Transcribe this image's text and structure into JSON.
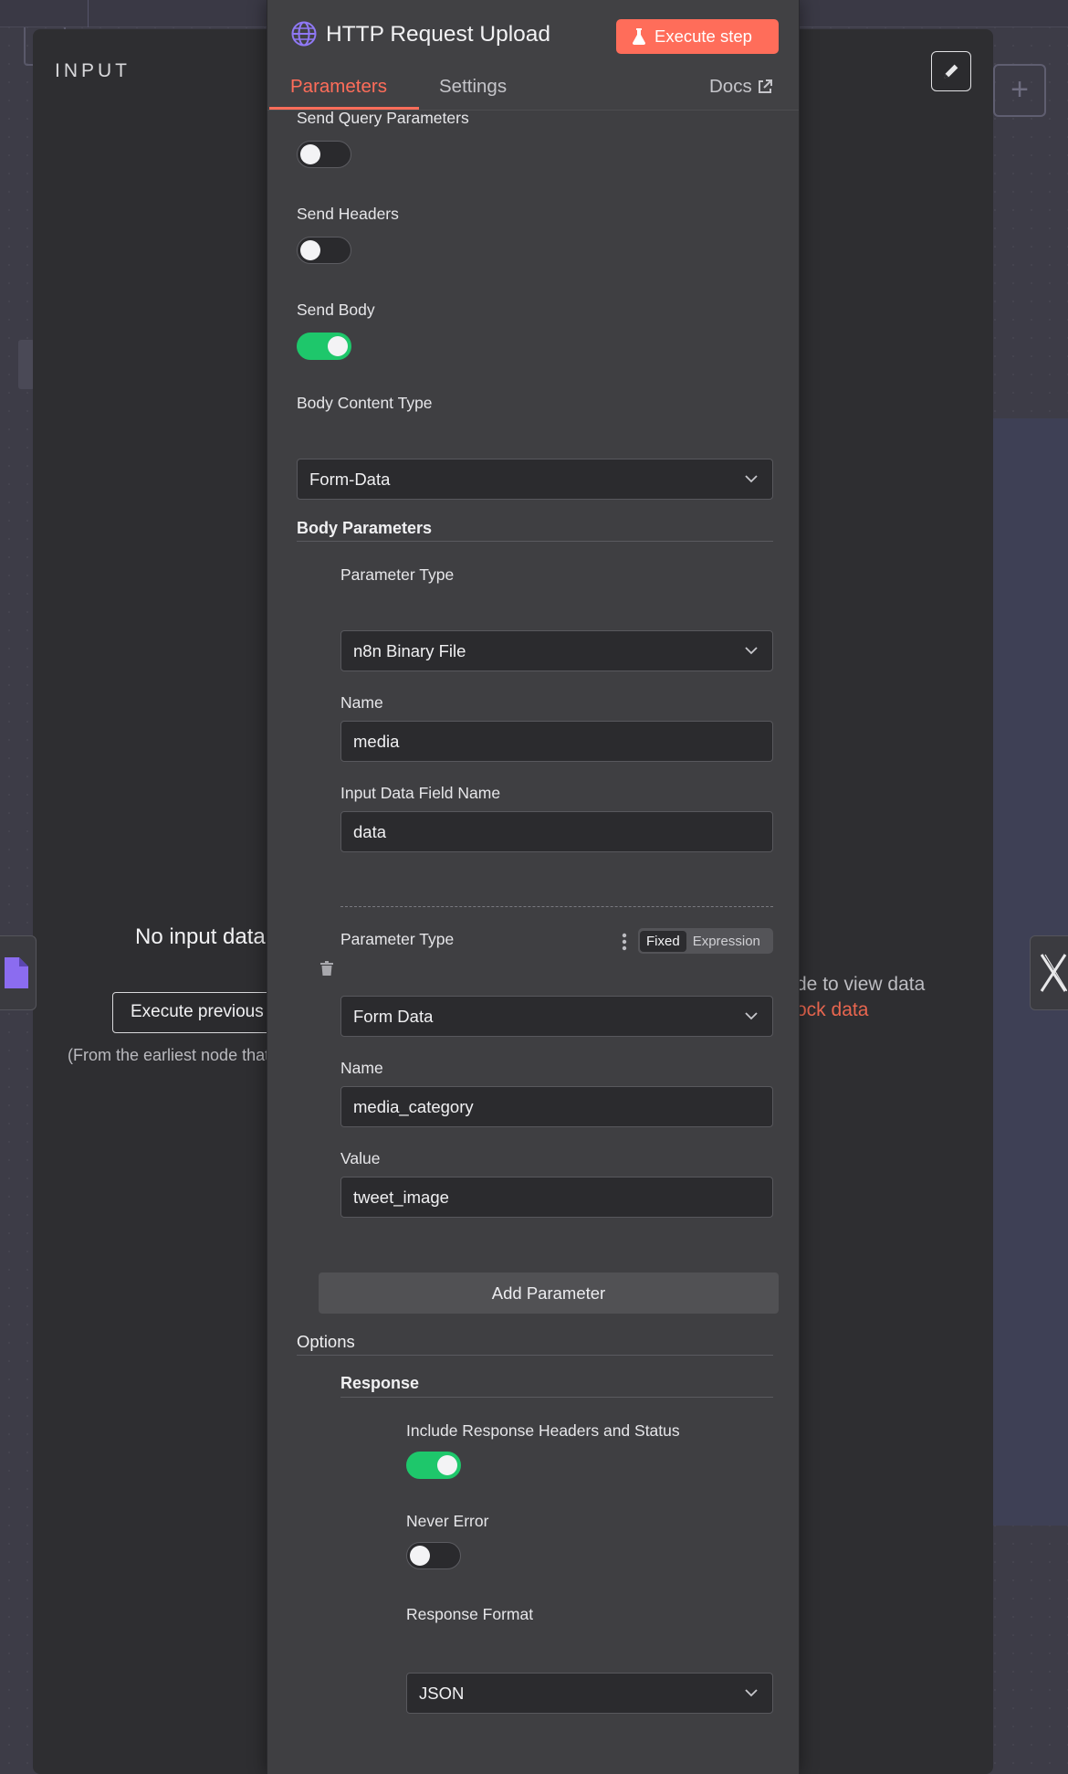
{
  "colors": {
    "accent": "#ff6d5a",
    "toggle_on": "#1ec76b",
    "panel_bg": "#3f3f42",
    "overlay_bg": "#2e2e31"
  },
  "input_panel": {
    "title": "INPUT",
    "empty_title": "No input data",
    "execute_previous_label": "Execute previous nodes",
    "hint": "(From the earliest node that needs it)"
  },
  "output_panel": {
    "hint": "de to view data",
    "mock_link": "ock data"
  },
  "node": {
    "title": "HTTP Request Upload",
    "icon": "globe-icon",
    "execute_label": "Execute step",
    "execute_icon": "flask-icon"
  },
  "tabs": [
    {
      "label": "Parameters",
      "active": true
    },
    {
      "label": "Settings",
      "active": false
    }
  ],
  "docs_label": "Docs",
  "params": {
    "send_query": {
      "label": "Send Query Parameters",
      "on": false
    },
    "send_headers": {
      "label": "Send Headers",
      "on": false
    },
    "send_body": {
      "label": "Send Body",
      "on": true
    },
    "body_content_type": {
      "label": "Body Content Type",
      "value": "Form-Data"
    },
    "body_parameters_label": "Body Parameters",
    "body_items": [
      {
        "type_label": "Parameter Type",
        "type_value": "n8n Binary File",
        "name_label": "Name",
        "name_value": "media",
        "field_label": "Input Data Field Name",
        "field_value": "data"
      },
      {
        "type_label": "Parameter Type",
        "type_value": "Form Data",
        "mode_fixed": "Fixed",
        "mode_expression": "Expression",
        "name_label": "Name",
        "name_value": "media_category",
        "value_label": "Value",
        "value_value": "tweet_image"
      }
    ],
    "add_parameter_label": "Add Parameter",
    "options_label": "Options",
    "response": {
      "label": "Response",
      "include_headers": {
        "label": "Include Response Headers and Status",
        "on": true
      },
      "never_error": {
        "label": "Never Error",
        "on": false
      },
      "format": {
        "label": "Response Format",
        "value": "JSON"
      }
    }
  }
}
